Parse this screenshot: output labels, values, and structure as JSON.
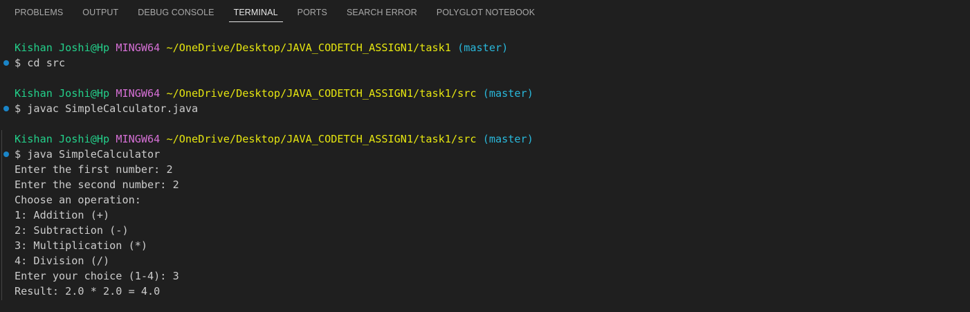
{
  "tabs": [
    {
      "label": "PROBLEMS",
      "active": false
    },
    {
      "label": "OUTPUT",
      "active": false
    },
    {
      "label": "DEBUG CONSOLE",
      "active": false
    },
    {
      "label": "TERMINAL",
      "active": true
    },
    {
      "label": "PORTS",
      "active": false
    },
    {
      "label": "SEARCH ERROR",
      "active": false
    },
    {
      "label": "POLYGLOT NOTEBOOK",
      "active": false
    }
  ],
  "prompts": [
    {
      "user": "Kishan Joshi@Hp",
      "system": "MINGW64",
      "path": "~/OneDrive/Desktop/JAVA_CODETCH_ASSIGN1/task1",
      "branch": "(master)",
      "command": "$ cd src"
    },
    {
      "user": "Kishan Joshi@Hp",
      "system": "MINGW64",
      "path": "~/OneDrive/Desktop/JAVA_CODETCH_ASSIGN1/task1/src",
      "branch": "(master)",
      "command": "$ javac SimpleCalculator.java"
    },
    {
      "user": "Kishan Joshi@Hp",
      "system": "MINGW64",
      "path": "~/OneDrive/Desktop/JAVA_CODETCH_ASSIGN1/task1/src",
      "branch": "(master)",
      "command": "$ java SimpleCalculator"
    }
  ],
  "output": [
    "Enter the first number: 2",
    "Enter the second number: 2",
    "Choose an operation:",
    "1: Addition (+)",
    "2: Subtraction (-)",
    "3: Multiplication (*)",
    "4: Division (/)",
    "Enter your choice (1-4): 3",
    "Result: 2.0 * 2.0 = 4.0"
  ],
  "colors": {
    "background": "#1f1f1f",
    "user": "#23d18b",
    "system": "#d670d6",
    "path": "#e5e510",
    "branch": "#29b8db",
    "text": "#cccccc",
    "decoration": "#1a85c8"
  }
}
